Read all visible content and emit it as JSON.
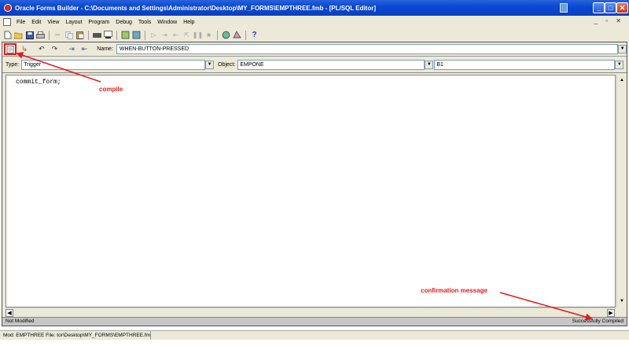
{
  "window": {
    "title": "Oracle Forms Builder - C:\\Documents and Settings\\Administrator\\Desktop\\MY_FORMS\\EMPTHREE.fmb - [PL/SQL Editor]",
    "minimize": "_",
    "maximize": "□",
    "close": "✕"
  },
  "menu": {
    "items": [
      "File",
      "Edit",
      "View",
      "Layout",
      "Program",
      "Debug",
      "Tools",
      "Window",
      "Help"
    ],
    "mdi_controls": "_ ▫ ✕"
  },
  "toolbar": {
    "icons": [
      "new-icon",
      "open-icon",
      "save-icon",
      "print-icon",
      "cut-icon",
      "copy-icon",
      "paste-icon",
      "connect-icon",
      "run-form-icon",
      "compile-all-icon",
      "run-icon",
      "step-icon",
      "debug-icon",
      "object-navigator-icon",
      "property-palette-icon",
      "help-icon"
    ],
    "help_glyph": "?"
  },
  "editor": {
    "name_label": "Name:",
    "name_value": "WHEN-BUTTON-PRESSED",
    "type_label": "Type:",
    "type_value": "Trigger",
    "object_label": "Object:",
    "object_value": "EMPONE",
    "item_value": "B1",
    "code": "commit_form;",
    "status_left": "Not Modified",
    "status_right": "Successfully Compiled"
  },
  "app_status": {
    "text": "Mod: EMPTHREE File: tor\\Desktop\\MY_FORMS\\EMPTHREE.fmb"
  },
  "annotations": {
    "compile": "compile",
    "confirmation": "confirmation message",
    "color": "#e31b1b"
  },
  "colors": {
    "titlebar": "#0a49d4",
    "chrome": "#ece9d8",
    "status": "#c6c6c6"
  }
}
